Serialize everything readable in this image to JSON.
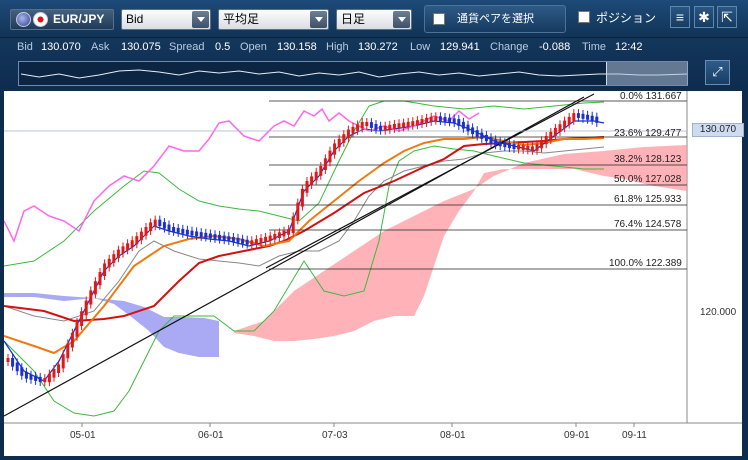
{
  "toolbar": {
    "pair": "EUR/JPY",
    "price_type": "Bid",
    "indicator": "平均足",
    "timeframe": "日足",
    "pair_select_label": "通貨ペアを選択",
    "position_label": "ポジション",
    "icons": [
      "menu-icon",
      "gear-icon",
      "expand-icon"
    ]
  },
  "quote": {
    "bid_label": "Bid",
    "bid": "130.070",
    "ask_label": "Ask",
    "ask": "130.075",
    "spread_label": "Spread",
    "spread": "0.5",
    "open_label": "Open",
    "open": "130.158",
    "high_label": "High",
    "high": "130.272",
    "low_label": "Low",
    "low": "129.941",
    "change_label": "Change",
    "change": "-0.088",
    "time_label": "Time",
    "time": "12:42"
  },
  "chart": {
    "current_price": "130.070",
    "price_tick": "120.000",
    "dates": [
      "05-01",
      "06-01",
      "07-03",
      "08-01",
      "09-01",
      "09-11"
    ],
    "fibonacci": [
      {
        "ratio": "0.0%",
        "price": "131.667"
      },
      {
        "ratio": "23.6%",
        "price": "129.477"
      },
      {
        "ratio": "38.2%",
        "price": "128.123"
      },
      {
        "ratio": "50.0%",
        "price": "127.028"
      },
      {
        "ratio": "61.8%",
        "price": "125.933"
      },
      {
        "ratio": "76.4%",
        "price": "124.578"
      },
      {
        "ratio": "100.0%",
        "price": "122.389"
      }
    ],
    "colors": {
      "bull_candle": "#e01818",
      "bear_candle": "#1a2fd0",
      "ma_short": "#1a2fd0",
      "ma_mid": "#f07a10",
      "ma_long": "#d41010",
      "bollinger": "#3cba3c",
      "chikou": "#ff66ee",
      "cloud_up": "#ff9aa0",
      "cloud_down": "#8c8cf0"
    }
  }
}
